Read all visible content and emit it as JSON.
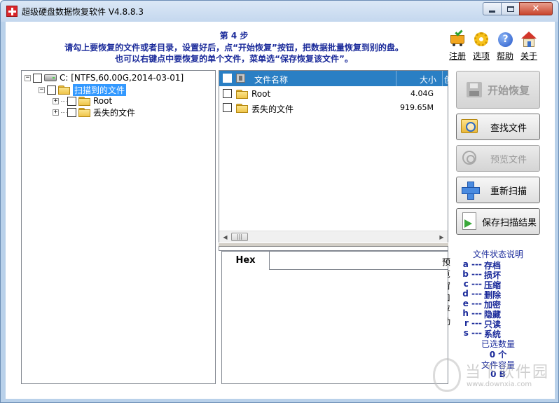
{
  "window": {
    "title": "超级硬盘数据恢复软件 V4.8.8.3",
    "minimize": "",
    "maximize": "",
    "close": "✕"
  },
  "header": {
    "step": "第 4 步",
    "line1": "请勾上要恢复的文件或者目录，设置好后，点“开始恢复”按钮，把数据批量恢复到别的盘。",
    "line2": "也可以右键点中要恢复的单个文件，菜单选“保存恢复该文件”。"
  },
  "top_icons": [
    {
      "label": "注册",
      "icon": "cart-icon"
    },
    {
      "label": "选项",
      "icon": "gear-icon"
    },
    {
      "label": "帮助",
      "icon": "help-icon"
    },
    {
      "label": "关于",
      "icon": "house-icon"
    }
  ],
  "tree": {
    "drive_label": "C:  [NTFS,60.00G,2014-03-01]",
    "scanned": "扫描到的文件",
    "children": [
      "Root",
      "丢失的文件"
    ]
  },
  "file_list": {
    "col_name": "文件名称",
    "col_size": "大小",
    "col_more": "创",
    "rows": [
      {
        "name": "Root",
        "size": "4.04G"
      },
      {
        "name": "丢失的文件",
        "size": "919.65M"
      }
    ]
  },
  "hex": {
    "tab": "Hex",
    "float_label": "预览窗口浮动"
  },
  "buttons": {
    "start": "开始恢复",
    "find": "查找文件",
    "preview": "预览文件",
    "rescan": "重新扫描",
    "save_scan": "保存扫描结果"
  },
  "legend": {
    "title": "文件状态说明",
    "items": [
      {
        "k": "a ---",
        "v": "存档"
      },
      {
        "k": "b ---",
        "v": "损坏"
      },
      {
        "k": "c ---",
        "v": "压缩"
      },
      {
        "k": "d ---",
        "v": "删除"
      },
      {
        "k": "e ---",
        "v": "加密"
      },
      {
        "k": "h ---",
        "v": "隐藏"
      },
      {
        "k": "r ---",
        "v": "只读"
      },
      {
        "k": "s ---",
        "v": "系统"
      }
    ],
    "selected_count_label": "已选数量",
    "selected_count": "0 个",
    "capacity_label": "文件容量",
    "capacity": "0 B"
  },
  "watermark": {
    "text": "当下软件园",
    "url": "www.downxia.com"
  }
}
